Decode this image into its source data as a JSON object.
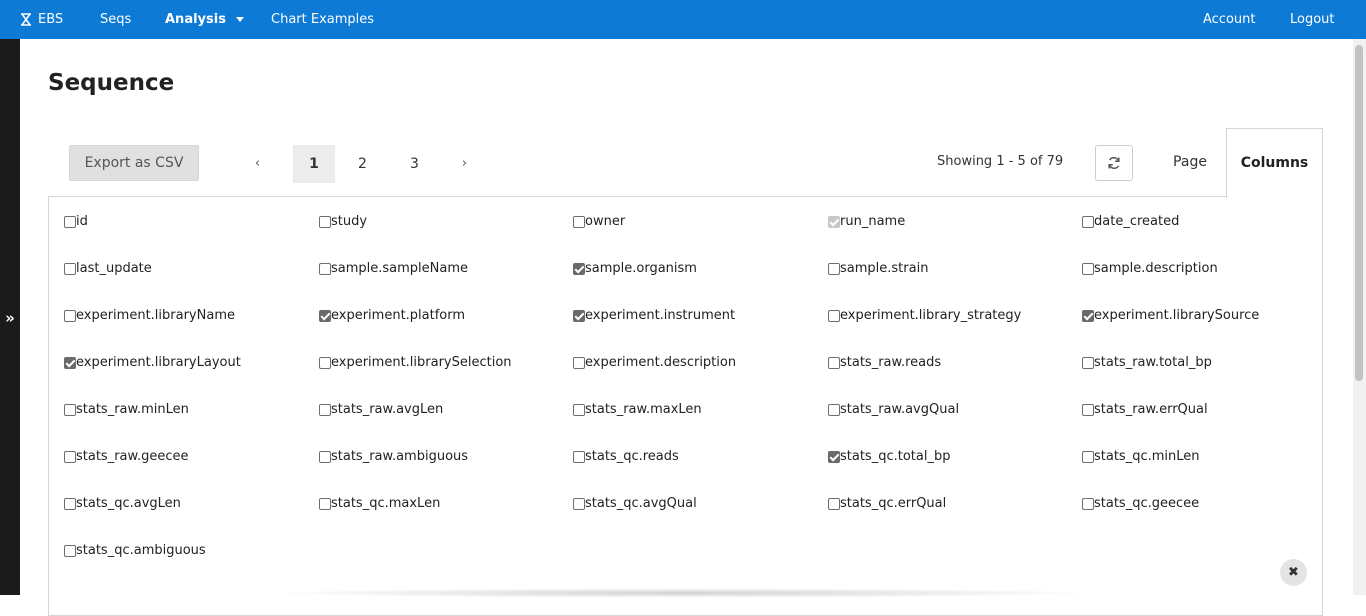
{
  "nav": {
    "brand": "EBS",
    "items": [
      {
        "label": "Seqs"
      },
      {
        "label": "Analysis"
      },
      {
        "label": "Chart Examples"
      }
    ],
    "right": [
      {
        "label": "Account"
      },
      {
        "label": "Logout"
      }
    ]
  },
  "sidebar": {
    "toggle_glyph": "»"
  },
  "page": {
    "title": "Sequence"
  },
  "toolbar": {
    "export_label": "Export as CSV",
    "prev_glyph": "‹",
    "next_glyph": "›",
    "pages": [
      "1",
      "2",
      "3"
    ],
    "current_page": "1",
    "showing": "Showing 1 - 5 of 79",
    "tabs": {
      "page": "Page",
      "columns": "Columns"
    },
    "active_tab": "Columns"
  },
  "columns": [
    {
      "label": "id",
      "checked": false
    },
    {
      "label": "study",
      "checked": false
    },
    {
      "label": "owner",
      "checked": false
    },
    {
      "label": "run_name",
      "checked": true,
      "disabled": true
    },
    {
      "label": "date_created",
      "checked": false
    },
    {
      "label": "last_update",
      "checked": false
    },
    {
      "label": "sample.sampleName",
      "checked": false
    },
    {
      "label": "sample.organism",
      "checked": true
    },
    {
      "label": "sample.strain",
      "checked": false
    },
    {
      "label": "sample.description",
      "checked": false
    },
    {
      "label": "experiment.libraryName",
      "checked": false
    },
    {
      "label": "experiment.platform",
      "checked": true
    },
    {
      "label": "experiment.instrument",
      "checked": true
    },
    {
      "label": "experiment.library_strategy",
      "checked": false
    },
    {
      "label": "experiment.librarySource",
      "checked": true
    },
    {
      "label": "experiment.libraryLayout",
      "checked": true
    },
    {
      "label": "experiment.librarySelection",
      "checked": false
    },
    {
      "label": "experiment.description",
      "checked": false
    },
    {
      "label": "stats_raw.reads",
      "checked": false
    },
    {
      "label": "stats_raw.total_bp",
      "checked": false
    },
    {
      "label": "stats_raw.minLen",
      "checked": false
    },
    {
      "label": "stats_raw.avgLen",
      "checked": false
    },
    {
      "label": "stats_raw.maxLen",
      "checked": false
    },
    {
      "label": "stats_raw.avgQual",
      "checked": false
    },
    {
      "label": "stats_raw.errQual",
      "checked": false
    },
    {
      "label": "stats_raw.geecee",
      "checked": false
    },
    {
      "label": "stats_raw.ambiguous",
      "checked": false
    },
    {
      "label": "stats_qc.reads",
      "checked": false
    },
    {
      "label": "stats_qc.total_bp",
      "checked": true
    },
    {
      "label": "stats_qc.minLen",
      "checked": false
    },
    {
      "label": "stats_qc.avgLen",
      "checked": false
    },
    {
      "label": "stats_qc.maxLen",
      "checked": false
    },
    {
      "label": "stats_qc.avgQual",
      "checked": false
    },
    {
      "label": "stats_qc.errQual",
      "checked": false
    },
    {
      "label": "stats_qc.geecee",
      "checked": false
    },
    {
      "label": "stats_qc.ambiguous",
      "checked": false
    }
  ],
  "close_glyph": "✖",
  "colors": {
    "navbar": "#0d7ad6",
    "sidebar": "#1b1b1b",
    "checked": "#6a6a6a"
  }
}
